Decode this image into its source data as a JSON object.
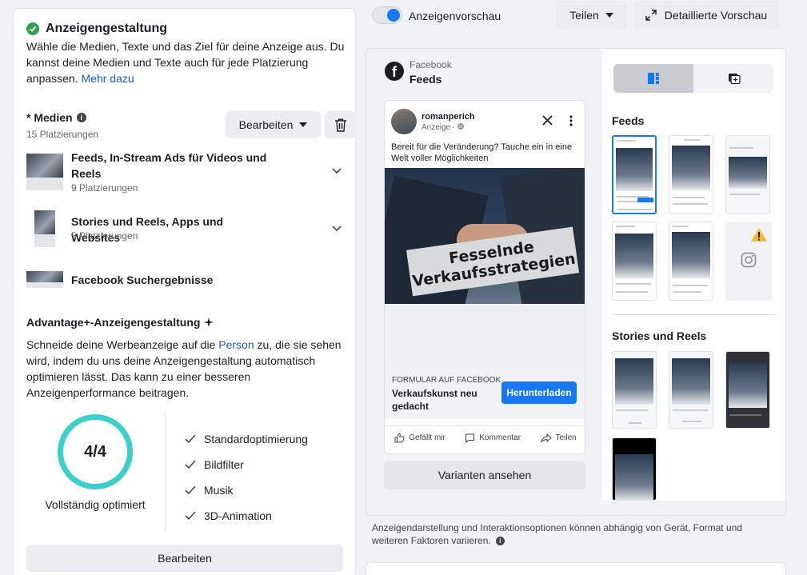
{
  "left": {
    "title": "Anzeigengestaltung",
    "description": "Wähle die Medien, Texte und das Ziel für deine Anzeige aus. Du kannst deine Medien und Texte auch für jede Platzierung anpassen.",
    "more_link": "Mehr dazu",
    "media": {
      "title": "* Medien",
      "subtitle": "15 Platzierungen",
      "edit_label": "Bearbeiten"
    },
    "placements": [
      {
        "title": "Feeds, In-Stream Ads für Videos und Reels",
        "subtitle": "9 Platzierungen"
      },
      {
        "title": "Stories und Reels, Apps und Websites",
        "subtitle": "5 Platzierungen"
      },
      {
        "title": "Facebook Suchergebnisse",
        "subtitle": ""
      }
    ],
    "advantage": {
      "title": "Advantage+-Anzeigengestaltung",
      "desc_before": "Schneide deine Werbeanzeige auf die ",
      "desc_link": "Person",
      "desc_after": " zu, die sie sehen wird, indem du uns deine Anzeigengestaltung automatisch optimieren lässt. Das kann zu einer besseren Anzeigenperformance beitragen.",
      "score": "4/4",
      "score_label": "Vollständig optimiert",
      "options": [
        "Standardoptimierung",
        "Bildfilter",
        "Musik",
        "3D-Animation"
      ],
      "edit_label": "Bearbeiten"
    }
  },
  "topbar": {
    "toggle_label": "Anzeigenvorschau",
    "toggle_on": true,
    "share_label": "Teilen",
    "detail_label": "Detaillierte Vorschau"
  },
  "preview": {
    "platform": "Facebook",
    "placement": "Feeds",
    "ad": {
      "page_name": "romanperich",
      "sponsored": "Anzeige ·",
      "text": "Bereit für die Veränderung? Tauche ein in eine Welt voller Möglichkeiten",
      "banner_line1": "Fesselnde",
      "banner_line2": "Verkaufsstrategien",
      "cta_kicker": "FORMULAR AUF FACEBOOK",
      "cta_title": "Verkaufskunst neu gedacht",
      "cta_button": "Herunterladen",
      "actions": [
        "Gefällt mir",
        "Kommentar",
        "Teilen"
      ]
    },
    "variants_label": "Varianten ansehen",
    "sections": {
      "feeds": "Feeds",
      "stories": "Stories und Reels"
    }
  },
  "footer_note": "Anzeigendarstellung und Interaktionsoptionen können abhängig von Gerät, Format und weiteren Faktoren variieren.",
  "colors": {
    "accent": "#1877f2",
    "success": "#31a24c",
    "ring": "#3dcfc9",
    "warning": "#f7b928",
    "link": "#1a5bc4"
  }
}
